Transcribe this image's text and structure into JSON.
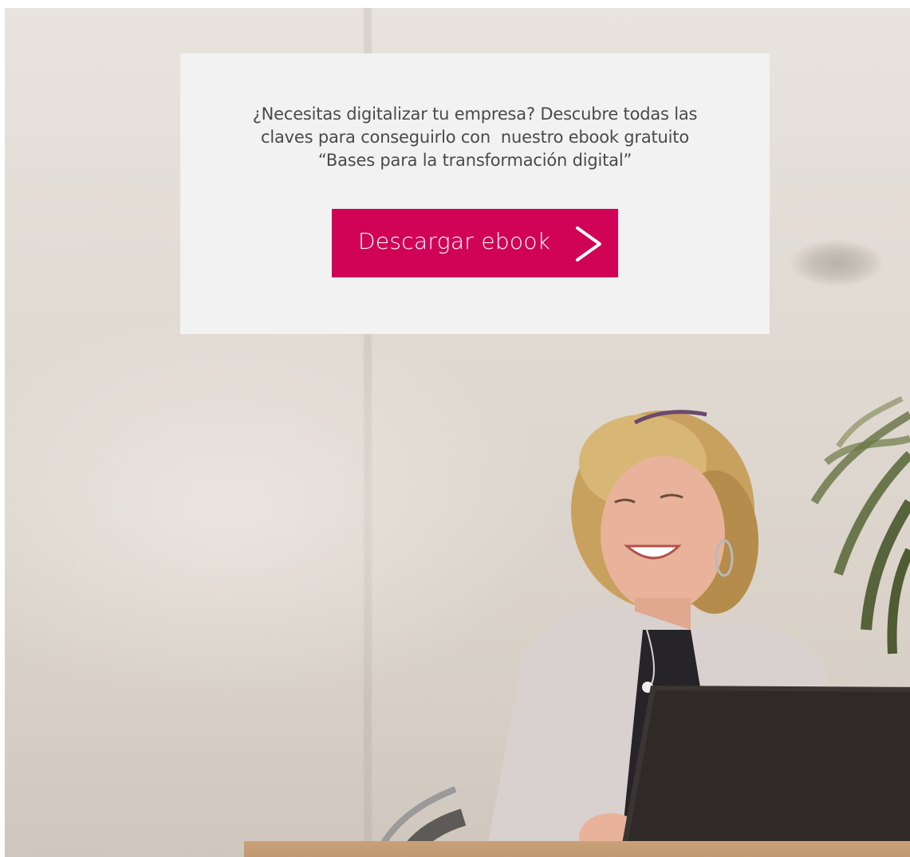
{
  "promo": {
    "text_lines": [
      "¿Necesitas digitalizar tu empresa? Descubre todas las",
      "claves para conseguirlo con  nuestro ebook gratuito",
      "“Bases para la transformación digital”"
    ],
    "button_label": "Descargar ebook",
    "button_icon": "chevron-right-icon",
    "accent_color": "#d10357",
    "card_color": "#f1f2f1",
    "text_color": "#4a4a4a"
  },
  "background": {
    "image_subject": "smiling woman at a laptop in an office"
  }
}
